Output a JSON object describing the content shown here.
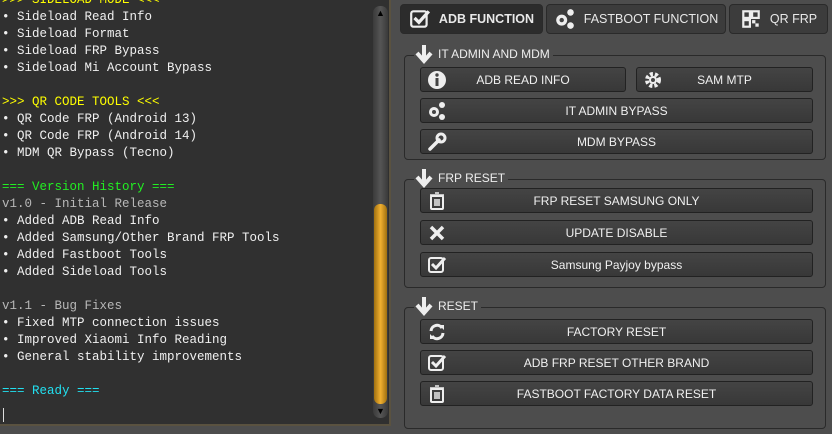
{
  "log": {
    "lines": [
      {
        "t": ">>> SIDELOAD MODE <<<",
        "c": "y"
      },
      {
        "t": "• Sideload Read Info",
        "c": ""
      },
      {
        "t": "• Sideload Format",
        "c": ""
      },
      {
        "t": "• Sideload FRP Bypass",
        "c": ""
      },
      {
        "t": "• Sideload Mi Account Bypass",
        "c": ""
      },
      {
        "t": "",
        "c": ""
      },
      {
        "t": ">>> QR CODE TOOLS <<<",
        "c": "y"
      },
      {
        "t": "• QR Code FRP (Android 13)",
        "c": ""
      },
      {
        "t": "• QR Code FRP (Android 14)",
        "c": ""
      },
      {
        "t": "• MDM QR Bypass (Tecno)",
        "c": ""
      },
      {
        "t": "",
        "c": ""
      },
      {
        "t": "=== Version History ===",
        "c": "g"
      },
      {
        "t": "v1.0 - Initial Release",
        "c": "gr"
      },
      {
        "t": "• Added ADB Read Info",
        "c": ""
      },
      {
        "t": "• Added Samsung/Other Brand FRP Tools",
        "c": ""
      },
      {
        "t": "• Added Fastboot Tools",
        "c": ""
      },
      {
        "t": "• Added Sideload Tools",
        "c": ""
      },
      {
        "t": "",
        "c": ""
      },
      {
        "t": "v1.1 - Bug Fixes",
        "c": "gr"
      },
      {
        "t": "• Fixed MTP connection issues",
        "c": ""
      },
      {
        "t": "• Improved Xiaomi Info Reading",
        "c": ""
      },
      {
        "t": "• General stability improvements",
        "c": ""
      },
      {
        "t": "",
        "c": ""
      },
      {
        "t": "=== Ready ===",
        "c": "c"
      }
    ],
    "scroll_position_percent": 90
  },
  "tabs": [
    {
      "label": "ADB FUNCTION",
      "icon": "checkbox-icon",
      "active": true
    },
    {
      "label": "FASTBOOT FUNCTION",
      "icon": "gears-icon"
    },
    {
      "label": "QR FRP",
      "icon": "qr-code-icon"
    }
  ],
  "groups": {
    "it_admin": {
      "title": "IT ADMIN AND MDM",
      "buttons": {
        "adb_read_info": "ADB READ INFO",
        "sam_mtp": "SAM MTP",
        "it_admin_bypass": "IT ADMIN BYPASS",
        "mdm_bypass": "MDM BYPASS"
      }
    },
    "frp": {
      "title": "FRP RESET",
      "buttons": {
        "frp_samsung": "FRP RESET SAMSUNG ONLY",
        "update_disable": "UPDATE DISABLE",
        "payjoy": "Samsung Payjoy bypass"
      }
    },
    "reset": {
      "title": "RESET",
      "buttons": {
        "factory": "FACTORY RESET",
        "adb_frp_other": "ADB FRP RESET OTHER BRAND",
        "fastboot_factory": "FASTBOOT FACTORY DATA RESET"
      }
    }
  }
}
